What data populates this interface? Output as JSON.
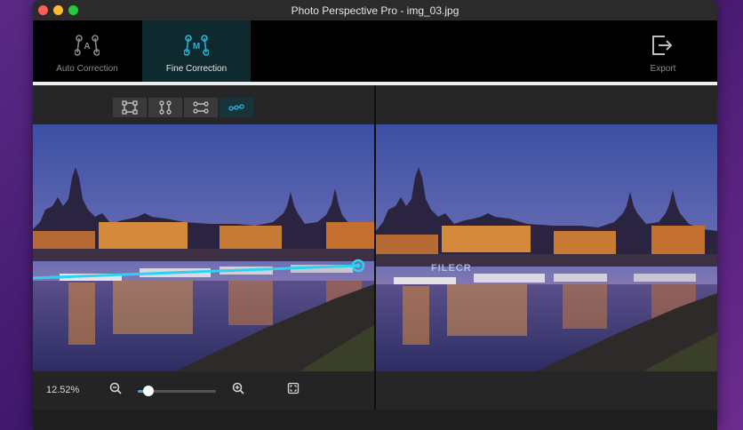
{
  "window": {
    "title": "Photo Perspective Pro - img_03.jpg"
  },
  "toolbar": {
    "auto_correction": "Auto Correction",
    "fine_correction": "Fine Correction",
    "export": "Export"
  },
  "editor": {
    "zoom_value": "12.52%",
    "zoom_level": 0.14,
    "modes": [
      "free-transform",
      "vertical",
      "horizontal",
      "line"
    ],
    "active_mode": "line"
  },
  "watermark": "FILECR",
  "colors": {
    "accent": "#2bb0d8",
    "active_tab_bg": "#0f2a2f"
  }
}
